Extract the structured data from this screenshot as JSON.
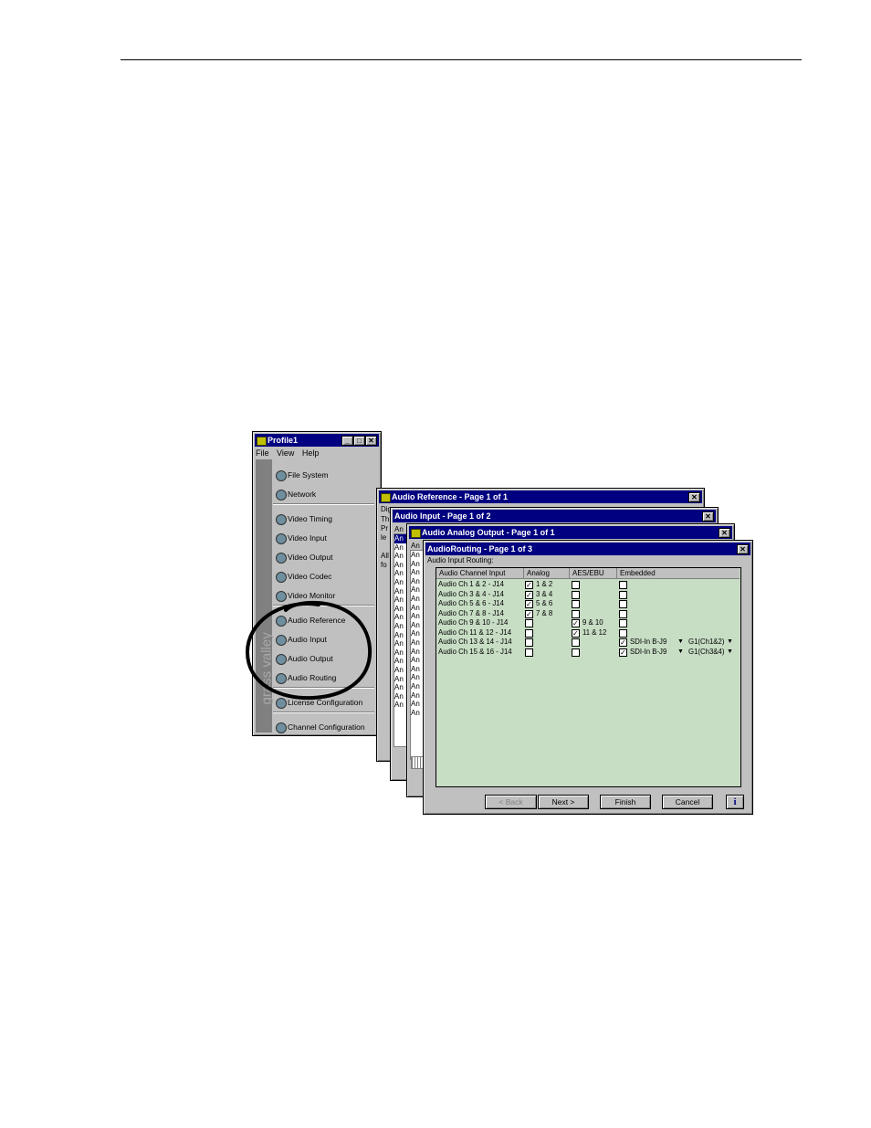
{
  "profile": {
    "title": "Profile1",
    "menu": [
      "File",
      "View",
      "Help"
    ],
    "brand": "grass valley",
    "items": [
      "File System",
      "Network",
      "Video Timing",
      "Video Input",
      "Video Output",
      "Video Codec",
      "Video Monitor",
      "Audio Reference",
      "Audio Input",
      "Audio Output",
      "Audio Routing",
      "License Configuration",
      "Channel Configuration"
    ]
  },
  "windows": {
    "ref": {
      "title": "Audio Reference - Page 1 of 1",
      "line1": "Dig",
      "lines": [
        "Th",
        "Pr",
        "le",
        "All",
        "fo"
      ]
    },
    "in": {
      "title": "Audio Input - Page 1 of 2",
      "header": "An"
    },
    "aout": {
      "title": "Audio Analog Output - Page 1 of 1",
      "header": "An"
    },
    "rout": {
      "title": "AudioRouting - Page 1 of 3",
      "subtitle": "Audio Input Routing:",
      "headers": [
        "Audio Channel Input",
        "Analog",
        "AES/EBU",
        "Embedded"
      ],
      "rows": [
        {
          "name": "Audio Ch 1 & 2 - J14",
          "analog": true,
          "analog_label": "1 & 2",
          "aes": false,
          "aes_label": "",
          "emb": false,
          "emb_src": "",
          "emb_grp": ""
        },
        {
          "name": "Audio Ch 3 & 4 - J14",
          "analog": true,
          "analog_label": "3 & 4",
          "aes": false,
          "aes_label": "",
          "emb": false,
          "emb_src": "",
          "emb_grp": ""
        },
        {
          "name": "Audio Ch 5 & 6 - J14",
          "analog": true,
          "analog_label": "5 & 6",
          "aes": false,
          "aes_label": "",
          "emb": false,
          "emb_src": "",
          "emb_grp": ""
        },
        {
          "name": "Audio Ch 7 & 8 - J14",
          "analog": true,
          "analog_label": "7 & 8",
          "aes": false,
          "aes_label": "",
          "emb": false,
          "emb_src": "",
          "emb_grp": ""
        },
        {
          "name": "Audio Ch 9 & 10 - J14",
          "analog": false,
          "analog_label": "",
          "aes": true,
          "aes_label": "9 & 10",
          "emb": false,
          "emb_src": "",
          "emb_grp": ""
        },
        {
          "name": "Audio Ch 11 & 12 - J14",
          "analog": false,
          "analog_label": "",
          "aes": true,
          "aes_label": "11 & 12",
          "emb": false,
          "emb_src": "",
          "emb_grp": ""
        },
        {
          "name": "Audio Ch 13 & 14 - J14",
          "analog": false,
          "analog_label": "",
          "aes": false,
          "aes_label": "",
          "emb": true,
          "emb_src": "SDI-In B-J9",
          "emb_grp": "G1(Ch1&2)"
        },
        {
          "name": "Audio Ch 15 & 16 - J14",
          "analog": false,
          "analog_label": "",
          "aes": false,
          "aes_label": "",
          "emb": true,
          "emb_src": "SDI-In B-J9",
          "emb_grp": "G1(Ch3&4)"
        }
      ],
      "buttons": {
        "back": "< Back",
        "next": "Next >",
        "finish": "Finish",
        "cancel": "Cancel",
        "info": "i"
      }
    }
  }
}
